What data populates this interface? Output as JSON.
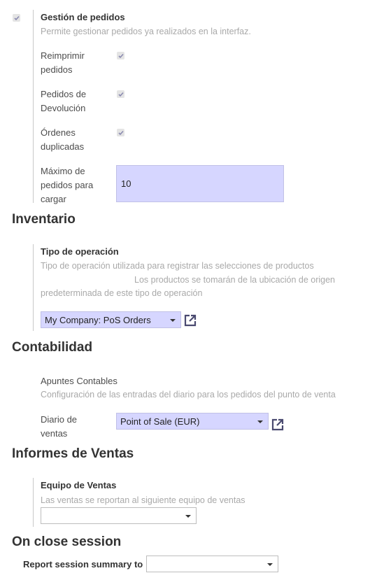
{
  "order_mgmt": {
    "title": "Gestión de pedidos",
    "description": "Permite gestionar pedidos ya realizados en la interfaz.",
    "reprint_label_1": "Reimprimir",
    "reprint_label_2": "pedidos",
    "refund_label_1": "Pedidos de",
    "refund_label_2": "Devolución",
    "dup_label_1": "Órdenes",
    "dup_label_2": "duplicadas",
    "max_label_1": "Máximo de",
    "max_label_2": "pedidos para",
    "max_label_3": "cargar",
    "max_value": "10"
  },
  "inventory": {
    "heading": "Inventario",
    "op_title": "Tipo de operación",
    "op_desc_1": "Tipo de operación utilizada para registrar las selecciones de productos",
    "op_desc_2": "Los productos se tomarán de la ubicación de origen",
    "op_desc_3": "predeterminada de este tipo de operación",
    "op_value": "My Company: PoS Orders"
  },
  "accounting": {
    "heading": "Contabilidad",
    "entries_title": "Apuntes Contables",
    "entries_desc": "Configuración de las entradas del diario para los pedidos del punto de venta",
    "journal_label_1": "Diario de",
    "journal_label_2": "ventas",
    "journal_value": "Point of Sale (EUR)"
  },
  "sales_reports": {
    "heading": "Informes de Ventas",
    "team_title": "Equipo de Ventas",
    "team_desc": "Las ventas se reportan al siguiente equipo de ventas",
    "team_value": ""
  },
  "close_session": {
    "heading": "On close session",
    "summary_label": "Report session summary to",
    "summary_value": ""
  },
  "icons": [
    "checkbox-checked-icon",
    "external-link-icon",
    "dropdown-caret-icon"
  ]
}
